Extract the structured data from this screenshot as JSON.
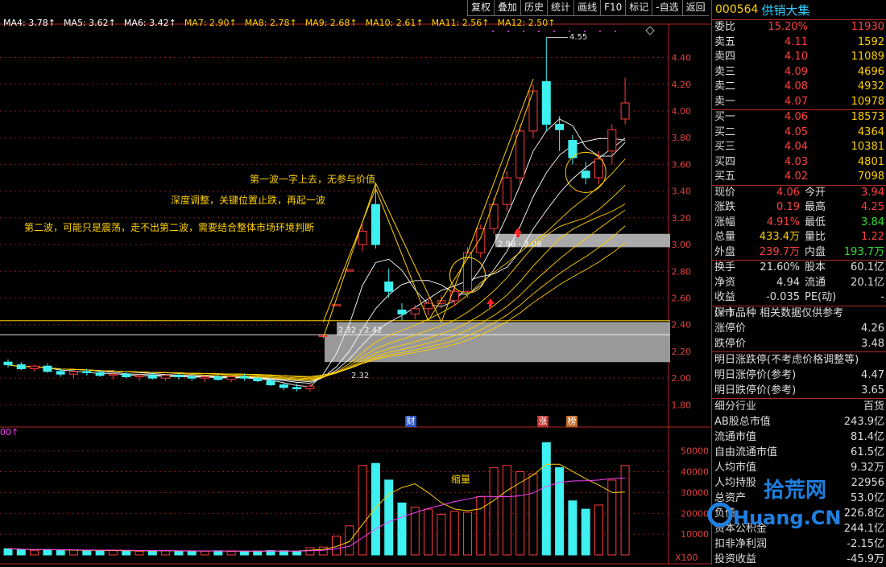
{
  "toolbar": [
    "复权",
    "叠加",
    "历史",
    "统计",
    "画线",
    "F10",
    "标记",
    "-自选",
    "返回"
  ],
  "ma_legend": [
    {
      "label": "MA4: 3.78",
      "color": "#ffffff"
    },
    {
      "label": "MA5: 3.62",
      "color": "#ffffff"
    },
    {
      "label": "MA6: 3.42",
      "color": "#ffffff"
    },
    {
      "label": "MA7: 2.90",
      "color": "#ffd000"
    },
    {
      "label": "MA8: 2.78",
      "color": "#ffd000"
    },
    {
      "label": "MA9: 2.68",
      "color": "#ffd000"
    },
    {
      "label": "MA10: 2.61",
      "color": "#ffd000"
    },
    {
      "label": "MA11: 2.56",
      "color": "#ffd000"
    },
    {
      "label": "MA12: 2.50",
      "color": "#ffd000"
    }
  ],
  "annotations": {
    "a1": "第一波一字上去，无参与价值",
    "a2": "深度调整，关键位置止跌，再起一波",
    "a3": "第二波，可能只是震荡，走不出第二波，需要结合整体市场环境判断",
    "shrink": "缩量",
    "zone1": "2.98 - 3.08",
    "zone2": "2.32 - 2.42",
    "low": "2.32",
    "high": "4.55"
  },
  "signs": {
    "cai": "财",
    "zhang": "涨",
    "bang": "榜"
  },
  "vol_unit": "X100",
  "vol_marker": "00↑",
  "chart_data": {
    "type": "candlestick",
    "price_ticks": [
      4.4,
      4.2,
      4.0,
      3.8,
      3.6,
      3.4,
      3.2,
      3.0,
      2.8,
      2.6,
      2.4,
      2.2,
      2.0,
      1.8
    ],
    "vol_ticks": [
      50000,
      40000,
      30000,
      20000,
      10000
    ],
    "ylim": [
      1.73,
      4.62
    ],
    "candles": [
      [
        2.12,
        2.14,
        2.08,
        2.1
      ],
      [
        2.1,
        2.12,
        2.06,
        2.07
      ],
      [
        2.07,
        2.1,
        2.05,
        2.09
      ],
      [
        2.09,
        2.11,
        2.04,
        2.05
      ],
      [
        2.05,
        2.07,
        2.01,
        2.03
      ],
      [
        2.03,
        2.06,
        2.0,
        2.05
      ],
      [
        2.05,
        2.07,
        2.02,
        2.04
      ],
      [
        2.04,
        2.06,
        2.01,
        2.02
      ],
      [
        2.02,
        2.04,
        1.99,
        2.03
      ],
      [
        2.03,
        2.05,
        2.0,
        2.01
      ],
      [
        2.01,
        2.03,
        1.98,
        2.02
      ],
      [
        2.02,
        2.04,
        1.99,
        2.0
      ],
      [
        2.0,
        2.03,
        1.98,
        2.02
      ],
      [
        2.02,
        2.04,
        1.99,
        2.01
      ],
      [
        2.01,
        2.03,
        1.98,
        2.0
      ],
      [
        2.0,
        2.02,
        1.97,
        2.01
      ],
      [
        2.01,
        2.03,
        1.98,
        1.99
      ],
      [
        1.99,
        2.02,
        1.97,
        2.01
      ],
      [
        2.01,
        2.03,
        1.98,
        2.0
      ],
      [
        2.0,
        2.02,
        1.97,
        1.98
      ],
      [
        1.98,
        2.0,
        1.94,
        1.95
      ],
      [
        1.95,
        1.97,
        1.91,
        1.93
      ],
      [
        1.93,
        1.96,
        1.9,
        1.92
      ],
      [
        1.92,
        1.96,
        1.9,
        1.94
      ],
      [
        2.32,
        2.32,
        2.32,
        2.32
      ],
      [
        2.55,
        2.55,
        2.55,
        2.55
      ],
      [
        2.81,
        2.81,
        2.81,
        2.81
      ],
      [
        3.0,
        3.15,
        2.95,
        3.1
      ],
      [
        3.3,
        3.45,
        2.97,
        3.0
      ],
      [
        2.72,
        2.82,
        2.6,
        2.65
      ],
      [
        2.51,
        2.56,
        2.43,
        2.48
      ],
      [
        2.48,
        2.55,
        2.44,
        2.52
      ],
      [
        2.52,
        2.6,
        2.47,
        2.56
      ],
      [
        2.56,
        2.62,
        2.52,
        2.58
      ],
      [
        2.58,
        2.68,
        2.54,
        2.65
      ],
      [
        2.65,
        2.98,
        2.6,
        2.94
      ],
      [
        2.94,
        3.15,
        2.9,
        3.12
      ],
      [
        3.12,
        3.35,
        3.08,
        3.3
      ],
      [
        3.3,
        3.55,
        3.25,
        3.5
      ],
      [
        3.5,
        3.9,
        3.45,
        3.85
      ],
      [
        3.85,
        4.2,
        3.8,
        4.15
      ],
      [
        4.22,
        4.55,
        3.85,
        3.9
      ],
      [
        3.9,
        3.96,
        3.7,
        3.86
      ],
      [
        3.78,
        3.82,
        3.6,
        3.65
      ],
      [
        3.55,
        3.62,
        3.45,
        3.5
      ],
      [
        3.5,
        3.7,
        3.45,
        3.64
      ],
      [
        3.7,
        3.9,
        3.6,
        3.86
      ],
      [
        3.94,
        4.25,
        3.9,
        4.06
      ]
    ],
    "volumes": [
      3000,
      2500,
      2200,
      2600,
      2100,
      2300,
      2000,
      1900,
      2200,
      2100,
      1800,
      2000,
      2100,
      1700,
      1900,
      1800,
      2000,
      1700,
      1600,
      1900,
      2100,
      2000,
      1800,
      3500,
      3800,
      9000,
      14000,
      43000,
      44000,
      36000,
      25000,
      23000,
      22000,
      19500,
      21000,
      20500,
      28000,
      42000,
      43000,
      40000,
      39000,
      54000,
      42000,
      26000,
      22000,
      24000,
      36000,
      43000
    ],
    "vol_ylim": [
      0,
      58000
    ]
  }
}
